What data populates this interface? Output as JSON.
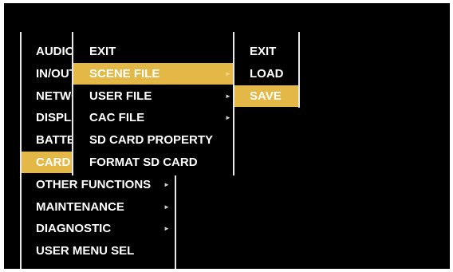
{
  "colors": {
    "background": "#000000",
    "text": "#ffffff",
    "highlight": "#e4b847",
    "divider": "#e8e8e8"
  },
  "main_menu": {
    "items": [
      {
        "label": "AUDIO",
        "arrow": false,
        "selected": false
      },
      {
        "label": "IN/OUT",
        "arrow": false,
        "selected": false
      },
      {
        "label": "NETWORK",
        "arrow": false,
        "selected": false
      },
      {
        "label": "DISPLAY",
        "arrow": false,
        "selected": false
      },
      {
        "label": "BATTERY",
        "arrow": false,
        "selected": false
      },
      {
        "label": "CARD",
        "arrow": false,
        "selected": true
      },
      {
        "label": "OTHER FUNCTIONS",
        "arrow": true,
        "selected": false
      },
      {
        "label": "MAINTENANCE",
        "arrow": true,
        "selected": false
      },
      {
        "label": "DIAGNOSTIC",
        "arrow": true,
        "selected": false
      },
      {
        "label": "USER MENU SEL",
        "arrow": false,
        "selected": false
      }
    ]
  },
  "card_menu": {
    "items": [
      {
        "label": "EXIT",
        "arrow": false,
        "selected": false
      },
      {
        "label": "SCENE FILE",
        "arrow": true,
        "selected": true
      },
      {
        "label": "USER FILE",
        "arrow": true,
        "selected": false
      },
      {
        "label": "CAC FILE",
        "arrow": true,
        "selected": false
      },
      {
        "label": "SD CARD PROPERTY",
        "arrow": false,
        "selected": false
      },
      {
        "label": "FORMAT SD CARD",
        "arrow": false,
        "selected": false
      }
    ]
  },
  "scene_menu": {
    "items": [
      {
        "label": "EXIT",
        "arrow": false,
        "selected": false
      },
      {
        "label": "LOAD",
        "arrow": false,
        "selected": false
      },
      {
        "label": "SAVE",
        "arrow": false,
        "selected": true
      }
    ]
  },
  "arrow_glyph": "►"
}
